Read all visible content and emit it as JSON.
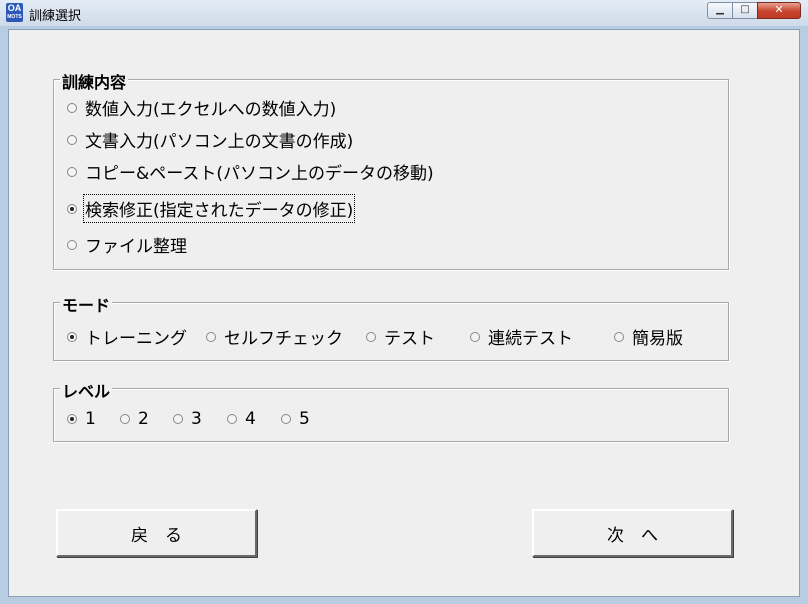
{
  "window": {
    "title": "訓練選択",
    "app_icon": {
      "top": "OA",
      "bottom": "MOTS"
    },
    "min_glyph": "▁",
    "max_glyph": "□",
    "close_glyph": "✕"
  },
  "training": {
    "legend": "訓練内容",
    "options": [
      {
        "label": "数値入力(エクセルへの数値入力)",
        "selected": false
      },
      {
        "label": "文書入力(パソコン上の文書の作成)",
        "selected": false
      },
      {
        "label": "コピー&ペースト(パソコン上のデータの移動)",
        "selected": false
      },
      {
        "label": "検索修正(指定されたデータの修正)",
        "selected": true
      },
      {
        "label": "ファイル整理",
        "selected": false
      }
    ]
  },
  "mode": {
    "legend": "モード",
    "options": [
      {
        "label": "トレーニング",
        "selected": true
      },
      {
        "label": "セルフチェック",
        "selected": false
      },
      {
        "label": "テスト",
        "selected": false
      },
      {
        "label": "連続テスト",
        "selected": false
      },
      {
        "label": "簡易版",
        "selected": false
      }
    ]
  },
  "level": {
    "legend": "レベル",
    "options": [
      {
        "label": "1",
        "selected": true
      },
      {
        "label": "2",
        "selected": false
      },
      {
        "label": "3",
        "selected": false
      },
      {
        "label": "4",
        "selected": false
      },
      {
        "label": "5",
        "selected": false
      }
    ]
  },
  "buttons": {
    "back": "戻　る",
    "next": "次　へ"
  }
}
